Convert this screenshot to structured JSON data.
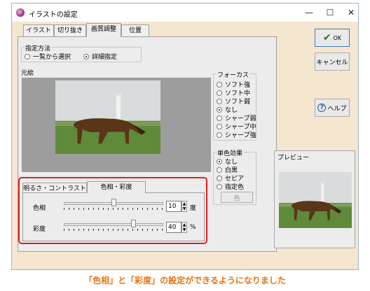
{
  "window": {
    "title": "イラストの設定",
    "controls": {
      "minimize": "—",
      "maximize": "☐",
      "close": "✕"
    }
  },
  "tabs": [
    "イラスト",
    "切り抜き",
    "画質調整",
    "位置"
  ],
  "selection_mode": {
    "label": "指定方法",
    "options": [
      {
        "label": "一覧から選択",
        "selected": false
      },
      {
        "label": "詳細指定",
        "selected": true
      }
    ]
  },
  "original_label": "元絵",
  "focus": {
    "label": "フォーカス",
    "options": [
      {
        "label": "ソフト強",
        "selected": false
      },
      {
        "label": "ソフト中",
        "selected": false
      },
      {
        "label": "ソフト弱",
        "selected": false
      },
      {
        "label": "なし",
        "selected": true
      },
      {
        "label": "シャープ弱",
        "selected": false
      },
      {
        "label": "シャープ中",
        "selected": false
      },
      {
        "label": "シャープ強",
        "selected": false
      }
    ]
  },
  "mono": {
    "label": "単色効果",
    "options": [
      {
        "label": "なし",
        "selected": true
      },
      {
        "label": "白黒",
        "selected": false
      },
      {
        "label": "セピア",
        "selected": false
      },
      {
        "label": "指定色",
        "selected": false
      }
    ],
    "color_button": "色"
  },
  "subtabs": [
    "明るさ・コントラスト",
    "色相・彩度"
  ],
  "hue": {
    "label": "色相",
    "value": "10",
    "unit": "度",
    "level": 0.5
  },
  "saturation": {
    "label": "彩度",
    "value": "40",
    "unit": "%",
    "level": 0.7
  },
  "buttons": {
    "ok": "OK",
    "cancel": "キャンセル",
    "help": "ヘルプ"
  },
  "preview_label": "プレビュー",
  "caption": "「色相」と「彩度」の設定ができるようになりました",
  "colors": {
    "highlight": "#e02020",
    "caption": "#e8730f",
    "ok_check": "#1a7a1a"
  }
}
